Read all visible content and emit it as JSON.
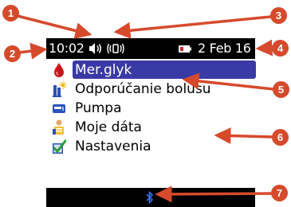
{
  "status_bar": {
    "time": "10:02",
    "date": "2 Feb 16",
    "icons": [
      "speaker-icon",
      "vibrate-icon",
      "battery-icon"
    ]
  },
  "menu": {
    "items": [
      {
        "label": "Mer.glyk",
        "icon": "blood-drop-icon",
        "selected": true
      },
      {
        "label": "Odporúčanie bolusu",
        "icon": "bolus-advice-icon",
        "selected": false
      },
      {
        "label": "Pumpa",
        "icon": "pump-icon",
        "selected": false
      },
      {
        "label": "Moje dáta",
        "icon": "my-data-icon",
        "selected": false
      },
      {
        "label": "Nastavenia",
        "icon": "settings-check-icon",
        "selected": false
      }
    ]
  },
  "bottom_bar": {
    "icon": "bluetooth-icon"
  },
  "callouts": [
    "1",
    "2",
    "3",
    "4",
    "5",
    "6",
    "7"
  ],
  "colors": {
    "callout": "#d64a2c",
    "selection": "#3a3aa6",
    "bar": "#000000"
  }
}
